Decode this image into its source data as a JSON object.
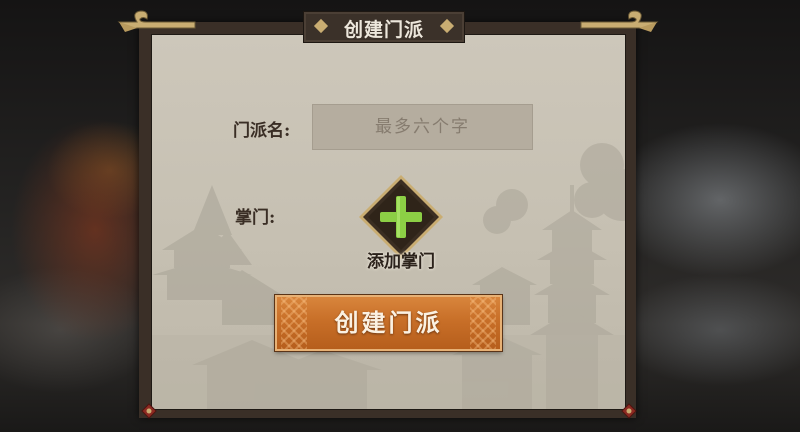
{
  "dialog": {
    "title": "创建门派"
  },
  "form": {
    "name_label": "门派名:",
    "name_placeholder": "最多六个字",
    "name_value": "",
    "leader_label": "掌门:",
    "add_leader_caption": "添加掌门"
  },
  "actions": {
    "create_label": "创建门派"
  },
  "colors": {
    "panel_frame": "#3a2f27",
    "panel_paper": "#cdc7ba",
    "button_orange": "#c86f28",
    "plus_green": "#86c93f",
    "gold_trim": "#c9ad72"
  },
  "icons": {
    "add": "plus-icon",
    "corner": "cloud-corner-ornament",
    "knot": "chinese-knot-ornament"
  }
}
